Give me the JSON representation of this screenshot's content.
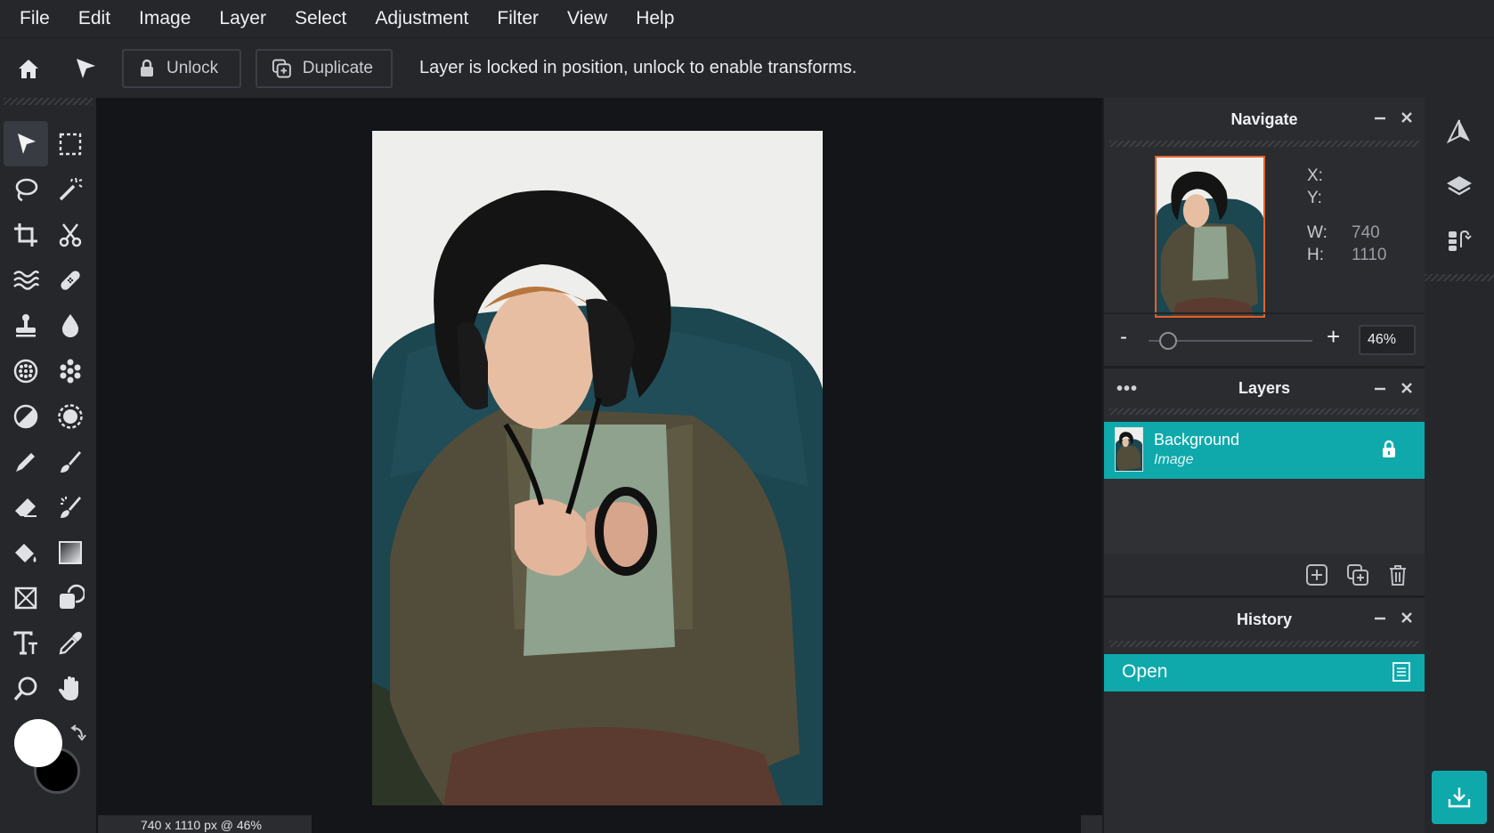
{
  "menu": [
    "File",
    "Edit",
    "Image",
    "Layer",
    "Select",
    "Adjustment",
    "Filter",
    "View",
    "Help"
  ],
  "toolbar": {
    "unlock_label": "Unlock",
    "duplicate_label": "Duplicate",
    "message": "Layer is locked in position, unlock to enable transforms."
  },
  "tools": [
    "move",
    "marquee",
    "lasso",
    "magic-wand",
    "crop",
    "cut",
    "liquify",
    "heal",
    "clone-stamp",
    "blur",
    "sponge",
    "pattern",
    "dodge-burn",
    "brightness",
    "pencil",
    "brush",
    "eraser",
    "color-replace",
    "fill",
    "gradient",
    "shape-transform",
    "shape",
    "text",
    "color-picker",
    "zoom",
    "hand"
  ],
  "colors": {
    "primary": "#ffffff",
    "secondary": "#000000",
    "accent": "#0fa9ac"
  },
  "status": {
    "text": "740 x 1110 px @ 46%"
  },
  "navigate": {
    "title": "Navigate",
    "x_label": "X:",
    "x_value": "",
    "y_label": "Y:",
    "y_value": "",
    "w_label": "W:",
    "w_value": "740",
    "h_label": "H:",
    "h_value": "1110",
    "zoom_minus": "-",
    "zoom_plus": "+",
    "zoom_value": "46%",
    "zoom_level": 0.12
  },
  "layers": {
    "title": "Layers",
    "menu": "•••",
    "items": [
      {
        "name": "Background",
        "type": "Image",
        "locked": true
      }
    ]
  },
  "history": {
    "title": "History",
    "items": [
      {
        "name": "Open"
      }
    ]
  }
}
